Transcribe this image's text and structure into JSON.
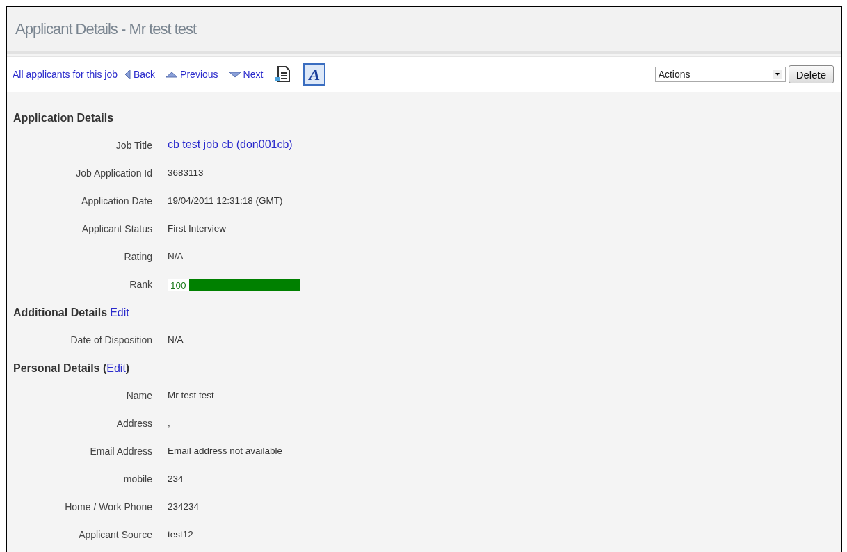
{
  "page_title": "Applicant Details - Mr test test",
  "toolbar": {
    "nav": [
      {
        "kind": "plain",
        "label": "All applicants for this job"
      },
      {
        "kind": "back",
        "label": "Back"
      },
      {
        "kind": "previous",
        "label": "Previous"
      },
      {
        "kind": "next",
        "label": "Next"
      }
    ],
    "font_button": "A",
    "actions": {
      "value": "Actions"
    },
    "delete_button": "Delete"
  },
  "sections": [
    {
      "heading": {
        "title": "Application Details"
      },
      "fields": [
        {
          "kind": "link",
          "label": "Job Title",
          "value": "cb test job cb (don001cb)"
        },
        {
          "kind": "text",
          "label": "Job Application Id",
          "value": "3683113"
        },
        {
          "kind": "text",
          "label": "Application Date",
          "value": "19/04/2011 12:31:18 (GMT)"
        },
        {
          "kind": "text",
          "label": "Applicant Status",
          "value": "First Interview"
        },
        {
          "kind": "text",
          "label": "Rating",
          "value": "N/A"
        },
        {
          "kind": "rank",
          "label": "Rank",
          "value": "100",
          "level": 1
        }
      ]
    },
    {
      "heading": {
        "title": "Additional Details",
        "link": "Edit"
      },
      "fields": [
        {
          "kind": "text",
          "label": "Date of Disposition",
          "value": "N/A"
        }
      ]
    },
    {
      "heading": {
        "title": "Personal Details (",
        "link": "Edit",
        "suffix": ")"
      },
      "fields": [
        {
          "kind": "text",
          "label": "Name",
          "value": "Mr test test"
        },
        {
          "kind": "text",
          "label": "Address",
          "value": ","
        },
        {
          "kind": "text",
          "label": "Email Address",
          "value": "Email address not available"
        },
        {
          "kind": "text",
          "label": "mobile",
          "value": "234"
        },
        {
          "kind": "text",
          "label": "Home / Work Phone",
          "value": "234234"
        },
        {
          "kind": "text",
          "label": "Applicant Source",
          "value": "test12"
        }
      ]
    }
  ]
}
